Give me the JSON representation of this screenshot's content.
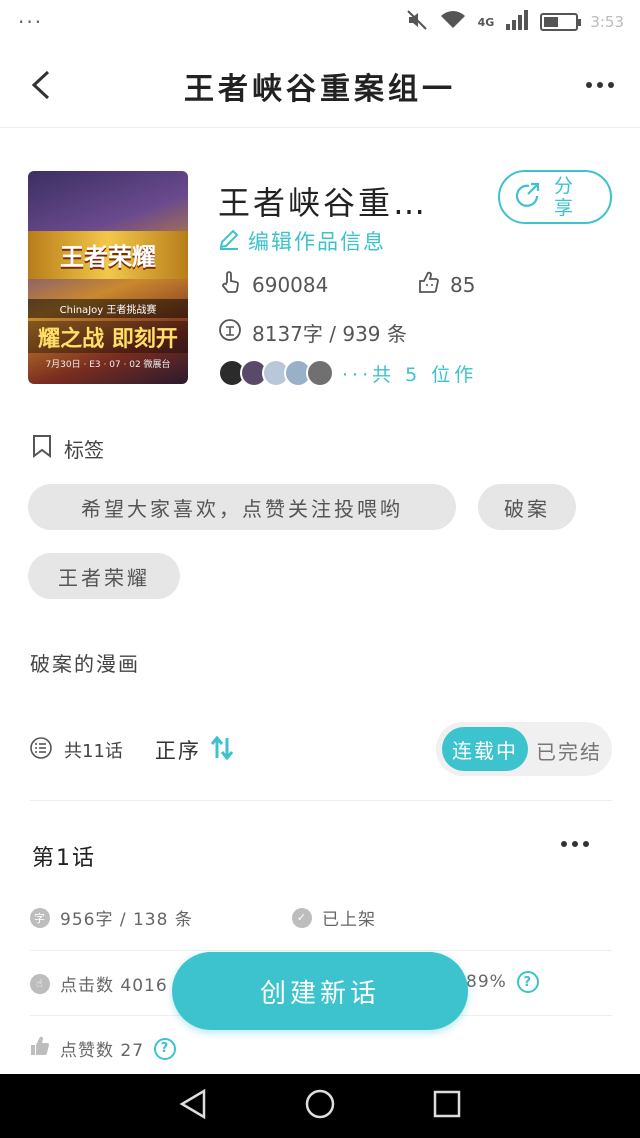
{
  "status_bar": {
    "menu_dots": "···",
    "network": "4G",
    "battery_level": 0.45,
    "time": "3:53"
  },
  "header": {
    "title": "王者峡谷重案组一"
  },
  "work": {
    "cover": {
      "logo_text": "王者荣耀",
      "subtitle": "ChinaJoy 王者挑战赛",
      "slogan": "耀之战 即刻开",
      "date_line": "7月30日 · E3 · 07 · 02 微展台"
    },
    "title": "王者峡谷重…",
    "share_label": "分享",
    "edit_label": "编辑作品信息",
    "clicks": "690084",
    "likes": "85",
    "words_label": "8137字 / 939 条",
    "authors_label": "···共 5 位作",
    "author_avatar_colors": [
      "#2b2b2b",
      "#5a4a6a",
      "#b8c8d8",
      "#9ab0c8",
      "#707070"
    ]
  },
  "tags": {
    "heading": "标签",
    "items": [
      "希望大家喜欢，点赞关注投喂哟",
      "破案",
      "王者荣耀"
    ]
  },
  "description": "破案的漫画",
  "episodes_bar": {
    "count_label": "共11话",
    "order_label": "正序",
    "status_on": "连载中",
    "status_off": "已完结"
  },
  "episode": {
    "title": "第1话",
    "words": "956字 / 138 条",
    "status": "已上架",
    "clicks_label": "点击数 4016",
    "rate_label": "89%",
    "likes_label": "点赞数 27",
    "help_mark": "?"
  },
  "create_button": "创建新话",
  "colors": {
    "accent": "#3cc3cd",
    "tag_bg": "#e6e6e6",
    "toggle_bg": "#f0f0f0",
    "nav_bar": "#000000"
  }
}
